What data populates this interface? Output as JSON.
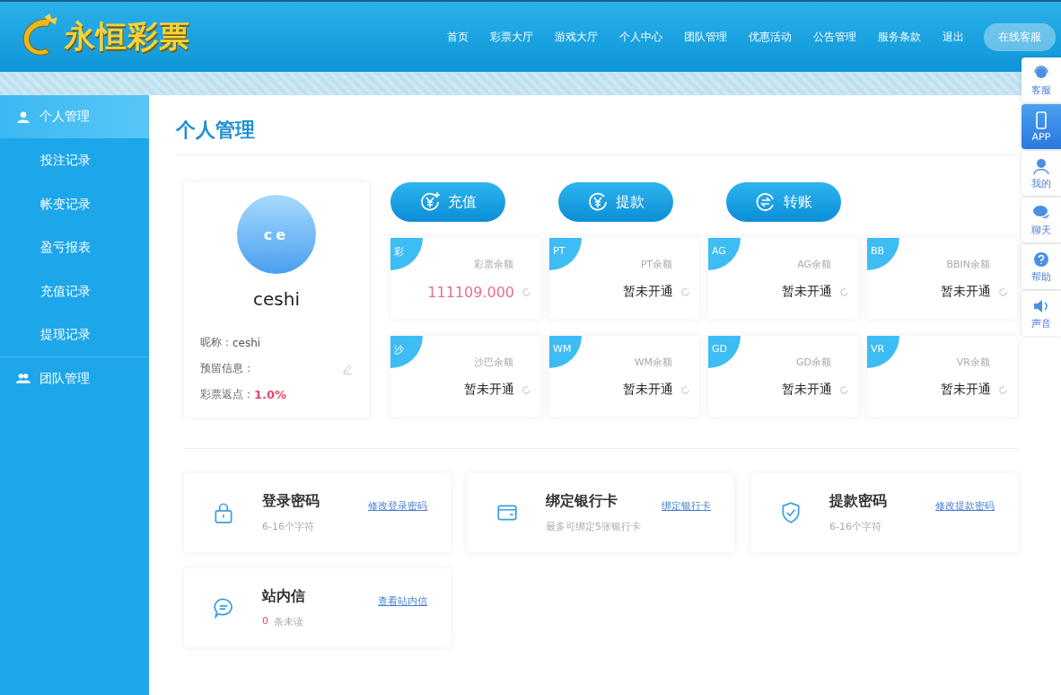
{
  "header": {
    "logo_text": "永恒彩票",
    "nav": [
      {
        "label": "首页"
      },
      {
        "label": "彩票大厅"
      },
      {
        "label": "游戏大厅"
      },
      {
        "label": "个人中心"
      },
      {
        "label": "团队管理"
      },
      {
        "label": "优惠活动"
      },
      {
        "label": "公告管理"
      },
      {
        "label": "服务条款"
      },
      {
        "label": "退出"
      }
    ],
    "service_button": "在线客服"
  },
  "sidebar": {
    "groups": [
      {
        "label": "个人管理",
        "selected": true,
        "children": [
          {
            "label": "投注记录"
          },
          {
            "label": "帐变记录"
          },
          {
            "label": "盈亏报表"
          },
          {
            "label": "充值记录"
          },
          {
            "label": "提现记录"
          }
        ]
      },
      {
        "label": "团队管理",
        "selected": false
      }
    ]
  },
  "page_title": "个人管理",
  "profile": {
    "avatar_text": "ce",
    "username": "ceshi",
    "fields": [
      {
        "label": "昵称：",
        "value": "ceshi",
        "kind": "plain"
      },
      {
        "label": "预留信息：",
        "kind": "editable"
      },
      {
        "label": "彩票返点：",
        "value": "1.0%",
        "kind": "highlight"
      }
    ]
  },
  "actions": [
    {
      "label": "充值"
    },
    {
      "label": "提款"
    },
    {
      "label": "转账"
    }
  ],
  "balances": [
    {
      "tag": "彩",
      "label": "彩票余额",
      "value": "111109.000",
      "opened": true
    },
    {
      "tag": "PT",
      "label": "PT余额",
      "value": "暂未开通",
      "opened": false
    },
    {
      "tag": "AG",
      "label": "AG余额",
      "value": "暂未开通",
      "opened": false
    },
    {
      "tag": "BB",
      "label": "BBIN余额",
      "value": "暂未开通",
      "opened": false
    },
    {
      "tag": "沙",
      "label": "沙巴余额",
      "value": "暂未开通",
      "opened": false
    },
    {
      "tag": "WM",
      "label": "WM余额",
      "value": "暂未开通",
      "opened": false
    },
    {
      "tag": "GD",
      "label": "GD余额",
      "value": "暂未开通",
      "opened": false
    },
    {
      "tag": "VR",
      "label": "VR余额",
      "value": "暂未开通",
      "opened": false
    }
  ],
  "security": [
    {
      "title": "登录密码",
      "link": "修改登录密码",
      "hint": "6-16个字符"
    },
    {
      "title": "绑定银行卡",
      "link": "绑定银行卡",
      "hint": "最多可绑定5张银行卡"
    },
    {
      "title": "提款密码",
      "link": "修改提款密码",
      "hint": "6-16个字符"
    },
    {
      "title": "站内信",
      "link": "查看站内信",
      "count": "0",
      "hint": "条未读"
    }
  ],
  "float_toolbar": [
    {
      "label": "客服",
      "selected": false
    },
    {
      "label": "APP",
      "selected": true
    },
    {
      "label": "我的",
      "selected": false
    },
    {
      "label": "聊天",
      "selected": false
    },
    {
      "label": "帮助",
      "selected": false
    },
    {
      "label": "声音",
      "selected": false
    }
  ]
}
